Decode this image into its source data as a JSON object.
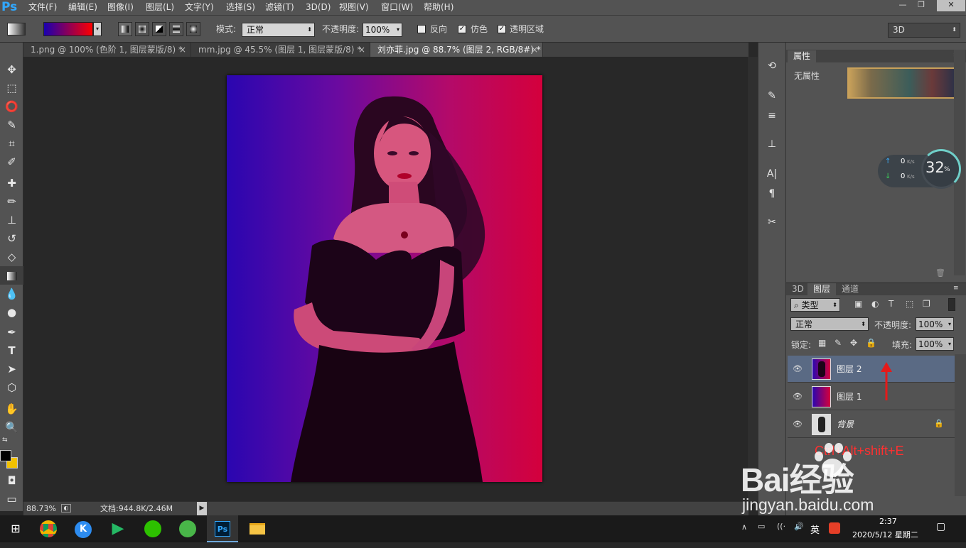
{
  "app": {
    "logo": "Ps"
  },
  "menu": [
    "文件(F)",
    "编辑(E)",
    "图像(I)",
    "图层(L)",
    "文字(Y)",
    "选择(S)",
    "滤镜(T)",
    "3D(D)",
    "视图(V)",
    "窗口(W)",
    "帮助(H)"
  ],
  "window_controls": {
    "minimize": "—",
    "restore": "❐",
    "close": "✕"
  },
  "options": {
    "mode_label": "模式:",
    "mode_value": "正常",
    "opacity_label": "不透明度:",
    "opacity_value": "100%",
    "reverse_label": "反向",
    "dither_label": "仿色",
    "transparency_label": "透明区域",
    "reverse_checked": false,
    "dither_checked": true,
    "transparency_checked": true,
    "workspace": "3D",
    "gradient_colors": [
      "#1a00b0",
      "#ff0000"
    ]
  },
  "tabs": [
    {
      "label": "1.png @ 100% (色阶 1, 图层蒙版/8) *",
      "close": "×"
    },
    {
      "label": "mm.jpg @ 45.5% (图层 1, 图层蒙版/8) *",
      "close": "×"
    },
    {
      "label": "刘亦菲.jpg @ 88.7% (图层 2, RGB/8#) *",
      "close": "×"
    }
  ],
  "status": {
    "zoom": "88.73%",
    "doc_info": "文档:944.8K/2.46M"
  },
  "properties": {
    "tab": "属性",
    "empty_label": "无属性"
  },
  "speed_widget": {
    "up": "0",
    "down": "0",
    "unit": "K/s",
    "percent": "32",
    "percent_unit": "%"
  },
  "layers_panel": {
    "tabs": [
      "3D",
      "图层",
      "通道"
    ],
    "filter_label": "类型",
    "blend_mode": "正常",
    "opacity_label": "不透明度:",
    "opacity_value": "100%",
    "lock_label": "锁定:",
    "fill_label": "填充:",
    "fill_value": "100%",
    "layers": [
      {
        "name": "图层 2",
        "selected": true
      },
      {
        "name": "图层 1",
        "selected": false
      },
      {
        "name": "背景",
        "selected": false,
        "locked": true
      }
    ],
    "annotation": "Ctrl+Alt+shift+E"
  },
  "watermark": {
    "brand": "Bai经验",
    "url": "jingyan.baidu.com"
  },
  "taskbar": {
    "apps": [
      "chrome-icon",
      "k-icon",
      "video-icon",
      "wechat-icon",
      "browser-icon",
      "photoshop-icon",
      "folder-icon"
    ],
    "ime": "英",
    "time": "2:37",
    "date": "2020/5/12 星期二"
  }
}
